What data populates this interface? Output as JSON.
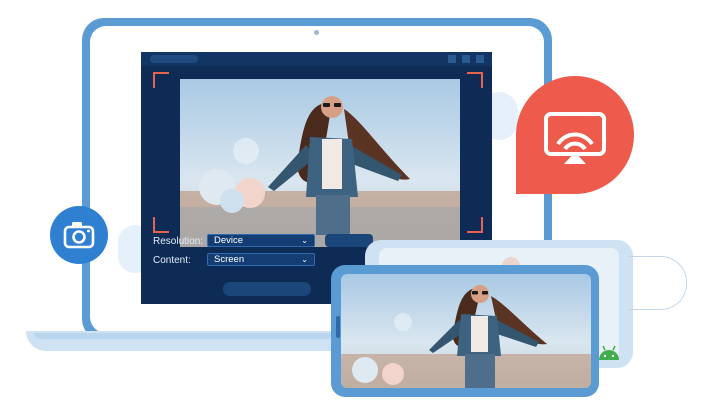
{
  "app": {
    "resolution_label": "Resolution:",
    "resolution_value": "Device",
    "content_label": "Content:",
    "content_value": "Screen"
  },
  "icons": {
    "camera": "camera-icon",
    "cast": "screen-cast-icon",
    "dropdown": "chevron-down-icon",
    "android": "android-icon"
  },
  "colors": {
    "app_background": "#0d2b55",
    "laptop_frame": "#5a9bd3",
    "cast_badge": "#ee5a4c",
    "camera_badge": "#2f80d0",
    "preview_corners": "#e8624f"
  }
}
